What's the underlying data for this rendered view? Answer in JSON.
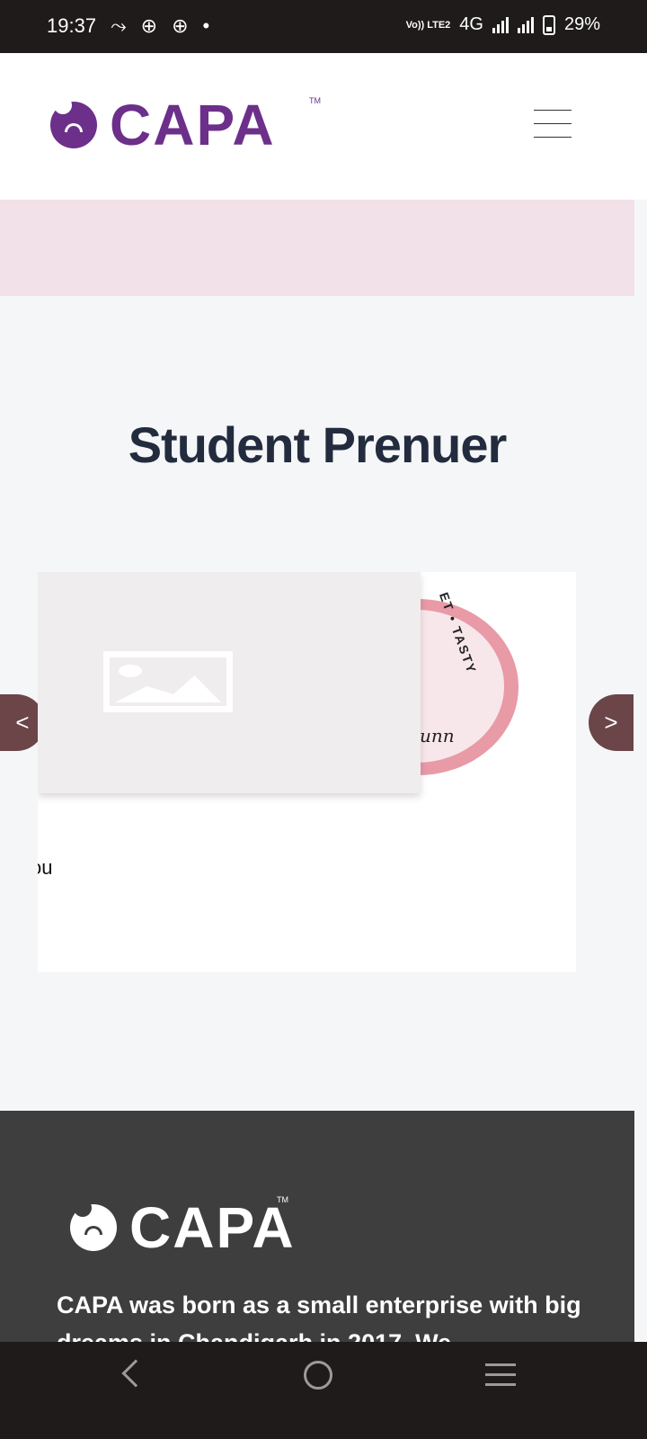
{
  "status_bar": {
    "time": "19:37",
    "volte": "Vo)) LTE2",
    "network": "4G",
    "battery": "29%"
  },
  "header": {
    "logo_text": "CAPA",
    "logo_tm": "TM"
  },
  "section": {
    "title": "Student Prenuer"
  },
  "carousel": {
    "prev_label": "<",
    "next_label": ">",
    "card": {
      "badge_text": "ET • TASTY",
      "badge_sign": "unn",
      "caption": "ou"
    }
  },
  "footer": {
    "logo_text": "CAPA",
    "logo_tm": "TM",
    "about_text": "CAPA was born as a small enterprise with big dreams in Chandigarh in 2017. We"
  }
}
